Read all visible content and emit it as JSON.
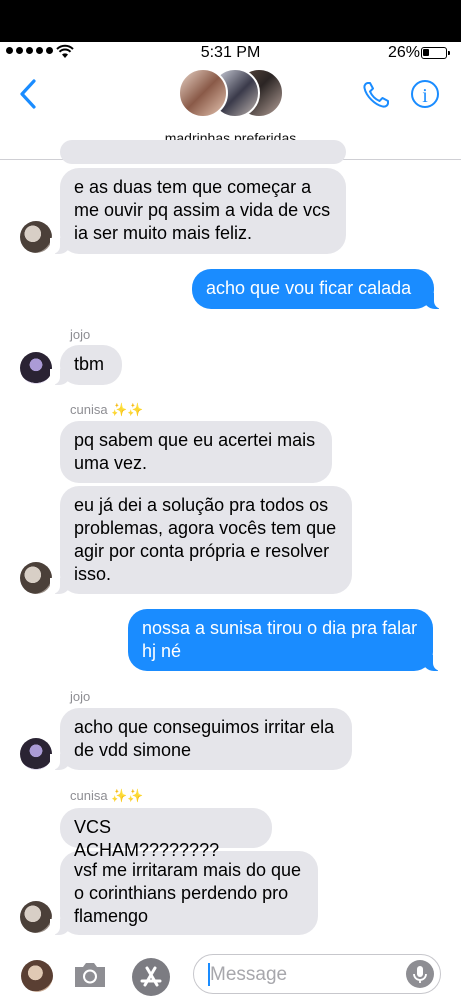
{
  "status_bar": {
    "time": "5:31 PM",
    "battery": "26%"
  },
  "header": {
    "group_name": "madrinhas preferidas"
  },
  "messages": [
    {
      "sender": "",
      "text": "e as duas tem que começar a me ouvir pq assim a vida de vcs ia ser muito mais feliz."
    },
    {
      "sender": "",
      "text": "acho que vou ficar calada"
    },
    {
      "sender": "jojo",
      "text": "tbm"
    },
    {
      "sender": "cunisa ✨✨",
      "text": "pq sabem que eu acertei mais uma vez."
    },
    {
      "sender": "",
      "text": "eu já dei a solução pra todos os problemas, agora vocês tem que agir por conta própria e resolver isso."
    },
    {
      "sender": "",
      "text": "nossa a sunisa tirou o dia pra falar hj né"
    },
    {
      "sender": "jojo",
      "text": "acho que conseguimos irritar ela de vdd simone"
    },
    {
      "sender": "cunisa ✨✨",
      "text": "VCS ACHAM????????"
    },
    {
      "sender": "",
      "text": "vsf me irritaram mais do que o corinthians perdendo pro flamengo"
    }
  ],
  "input": {
    "placeholder": "Message"
  },
  "colors": {
    "accent": "#1a8cff",
    "incoming": "#e5e5ea"
  }
}
